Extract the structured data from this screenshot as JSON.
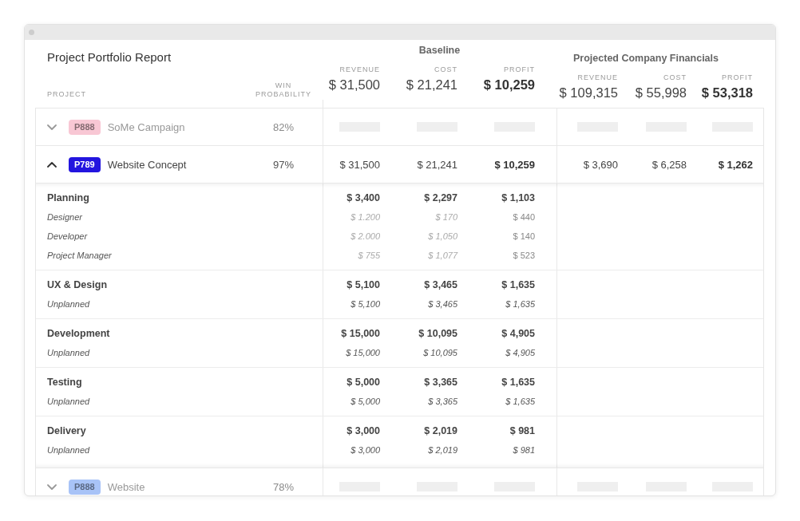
{
  "report": {
    "title": "Project Portfolio Report",
    "project_label": "PROJECT",
    "probability_label": "WIN PROBABILITY"
  },
  "groups": [
    {
      "title": "Baseline",
      "columns": [
        {
          "label": "REVENUE",
          "total": "$ 31,500",
          "strong": false
        },
        {
          "label": "COST",
          "total": "$ 21,241",
          "strong": false
        },
        {
          "label": "PROFIT",
          "total": "$ 10,259",
          "strong": true
        }
      ]
    },
    {
      "title": "Projected Company Financials",
      "columns": [
        {
          "label": "REVENUE",
          "total": "$ 109,315",
          "strong": false
        },
        {
          "label": "COST",
          "total": "$ 55,998",
          "strong": false
        },
        {
          "label": "PROFIT",
          "total": "$ 53,318",
          "strong": true
        }
      ]
    }
  ],
  "projects": [
    {
      "code": "P888",
      "color": "#f8c7d4",
      "name": "SoMe Campaign",
      "probability": "82%",
      "expanded": false,
      "loading": true
    },
    {
      "code": "P789",
      "color": "#2315df",
      "name": "Website Concept",
      "probability": "97%",
      "expanded": true,
      "loading": false,
      "values": [
        [
          "$ 31,500",
          "$ 21,241",
          "$ 10,259"
        ],
        [
          "$ 3,690",
          "$ 6,258",
          "$ 1,262"
        ]
      ],
      "phases": [
        {
          "name": "Planning",
          "values": [
            [
              "$ 3,400",
              "$ 2,297",
              "$ 1,103"
            ]
          ],
          "items": [
            {
              "kind": "role",
              "name": "Designer",
              "values": [
                [
                  "$ 1.200",
                  "$ 170",
                  "$ 440"
                ]
              ]
            },
            {
              "kind": "role",
              "name": "Developer",
              "values": [
                [
                  "$ 2.000",
                  "$ 1,050",
                  "$ 140"
                ]
              ]
            },
            {
              "kind": "role",
              "name": "Project Manager",
              "values": [
                [
                  "$ 755",
                  "$ 1,077",
                  "$ 523"
                ]
              ]
            }
          ]
        },
        {
          "name": "UX & Design",
          "values": [
            [
              "$ 5,100",
              "$ 3,465",
              "$ 1,635"
            ]
          ],
          "items": [
            {
              "kind": "unplanned",
              "name": "Unplanned",
              "values": [
                [
                  "$ 5,100",
                  "$ 3,465",
                  "$ 1,635"
                ]
              ]
            }
          ]
        },
        {
          "name": "Development",
          "values": [
            [
              "$ 15,000",
              "$ 10,095",
              "$ 4,905"
            ]
          ],
          "items": [
            {
              "kind": "unplanned",
              "name": "Unplanned",
              "values": [
                [
                  "$ 15,000",
                  "$ 10,095",
                  "$ 4,905"
                ]
              ]
            }
          ]
        },
        {
          "name": "Testing",
          "values": [
            [
              "$ 5,000",
              "$ 3,365",
              "$ 1,635"
            ]
          ],
          "items": [
            {
              "kind": "unplanned",
              "name": "Unplanned",
              "values": [
                [
                  "$ 5,000",
                  "$ 3,365",
                  "$ 1,635"
                ]
              ]
            }
          ]
        },
        {
          "name": "Delivery",
          "values": [
            [
              "$ 3,000",
              "$ 2,019",
              "$ 981"
            ]
          ],
          "items": [
            {
              "kind": "unplanned",
              "name": "Unplanned",
              "values": [
                [
                  "$ 3,000",
                  "$ 2,019",
                  "$ 981"
                ]
              ]
            }
          ]
        }
      ]
    },
    {
      "code": "P888",
      "color": "#a8c3f7",
      "name": "Website",
      "probability": "78%",
      "expanded": false,
      "loading": true
    }
  ]
}
